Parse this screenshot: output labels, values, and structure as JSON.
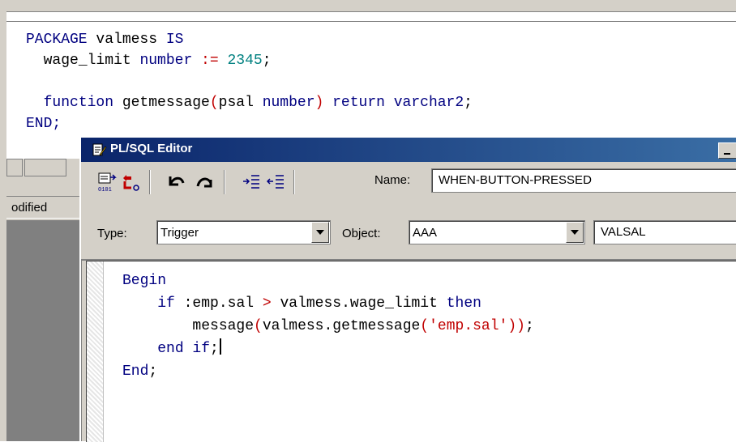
{
  "background_editor": {
    "code_lines": [
      {
        "kw1": "PACKAGE",
        "t1": " valmess ",
        "kw2": "IS",
        "t2": ""
      },
      {
        "indent": "  ",
        "t1": "wage_limit ",
        "kw1": "number",
        "op": " := ",
        "num": "2345",
        "t2": ";"
      },
      {
        "blank": ""
      },
      {
        "indent": "  ",
        "kw1": "function",
        "t1": " getmessage",
        "op1": "(",
        "t2": "psal ",
        "kw2": "number",
        "op2": ")",
        "sp": " ",
        "kw3": "return",
        "sp2": " ",
        "kw4": "varchar2",
        "t3": ";"
      },
      {
        "kw1": "END;"
      }
    ],
    "status_text": "odified"
  },
  "window": {
    "title": "PL/SQL Editor",
    "name_label": "Name:",
    "name_value": "WHEN-BUTTON-PRESSED",
    "type_label": "Type:",
    "type_value": "Trigger",
    "object_label": "Object:",
    "object_value": "AAA",
    "item_value": "VALSAL"
  },
  "trigger_code": {
    "begin": "Begin",
    "if_kw": "if",
    "cond": " :emp.sal ",
    "gt": ">",
    "limit": " valmess.wage_limit ",
    "then_kw": "then",
    "msg_call": "message",
    "p1": "(",
    "getmsg": "valmess.getmessage",
    "p2": "(",
    "str": "'emp.sal'",
    "p3": "))",
    "semi": ";",
    "end_if": "end if",
    "end_if_semi": ";",
    "end_kw": "End",
    "end_semi": ";"
  },
  "icons": [
    "compile-icon",
    "run-icon",
    "undo-icon",
    "redo-icon",
    "indent-icon",
    "outdent-icon",
    "editor-icon"
  ],
  "colors": {
    "keyword": "#000080",
    "number": "#008080",
    "operator": "#c00000",
    "titlebar_start": "#0a246a",
    "titlebar_end": "#3a6ea5"
  }
}
